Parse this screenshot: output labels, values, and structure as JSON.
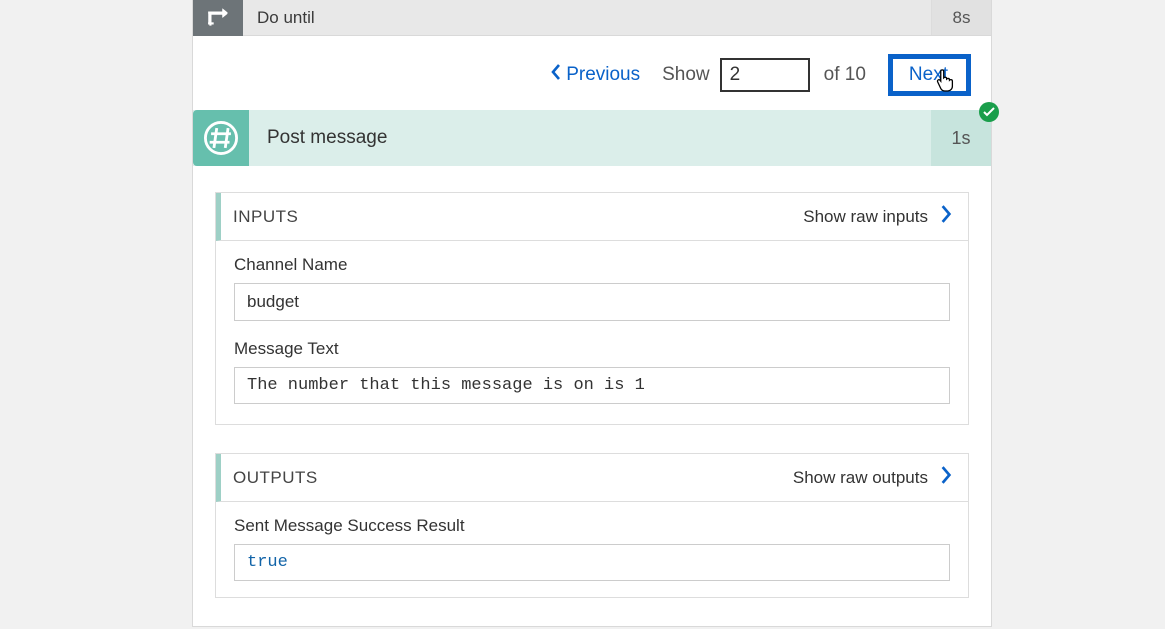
{
  "container": {
    "title": "Do until",
    "duration": "8s"
  },
  "pager": {
    "previous_label": "Previous",
    "show_label": "Show",
    "current": "2",
    "of_label": "of 10",
    "next_label": "Next"
  },
  "step": {
    "title": "Post message",
    "duration": "1s",
    "status": "success"
  },
  "inputs_panel": {
    "title": "INPUTS",
    "raw_link": "Show raw inputs",
    "fields": {
      "channel_name": {
        "label": "Channel Name",
        "value": "budget"
      },
      "message_text": {
        "label": "Message Text",
        "value": "The number that this message is on is 1"
      }
    }
  },
  "outputs_panel": {
    "title": "OUTPUTS",
    "raw_link": "Show raw outputs",
    "fields": {
      "sent_success": {
        "label": "Sent Message Success Result",
        "value": "true"
      }
    }
  }
}
